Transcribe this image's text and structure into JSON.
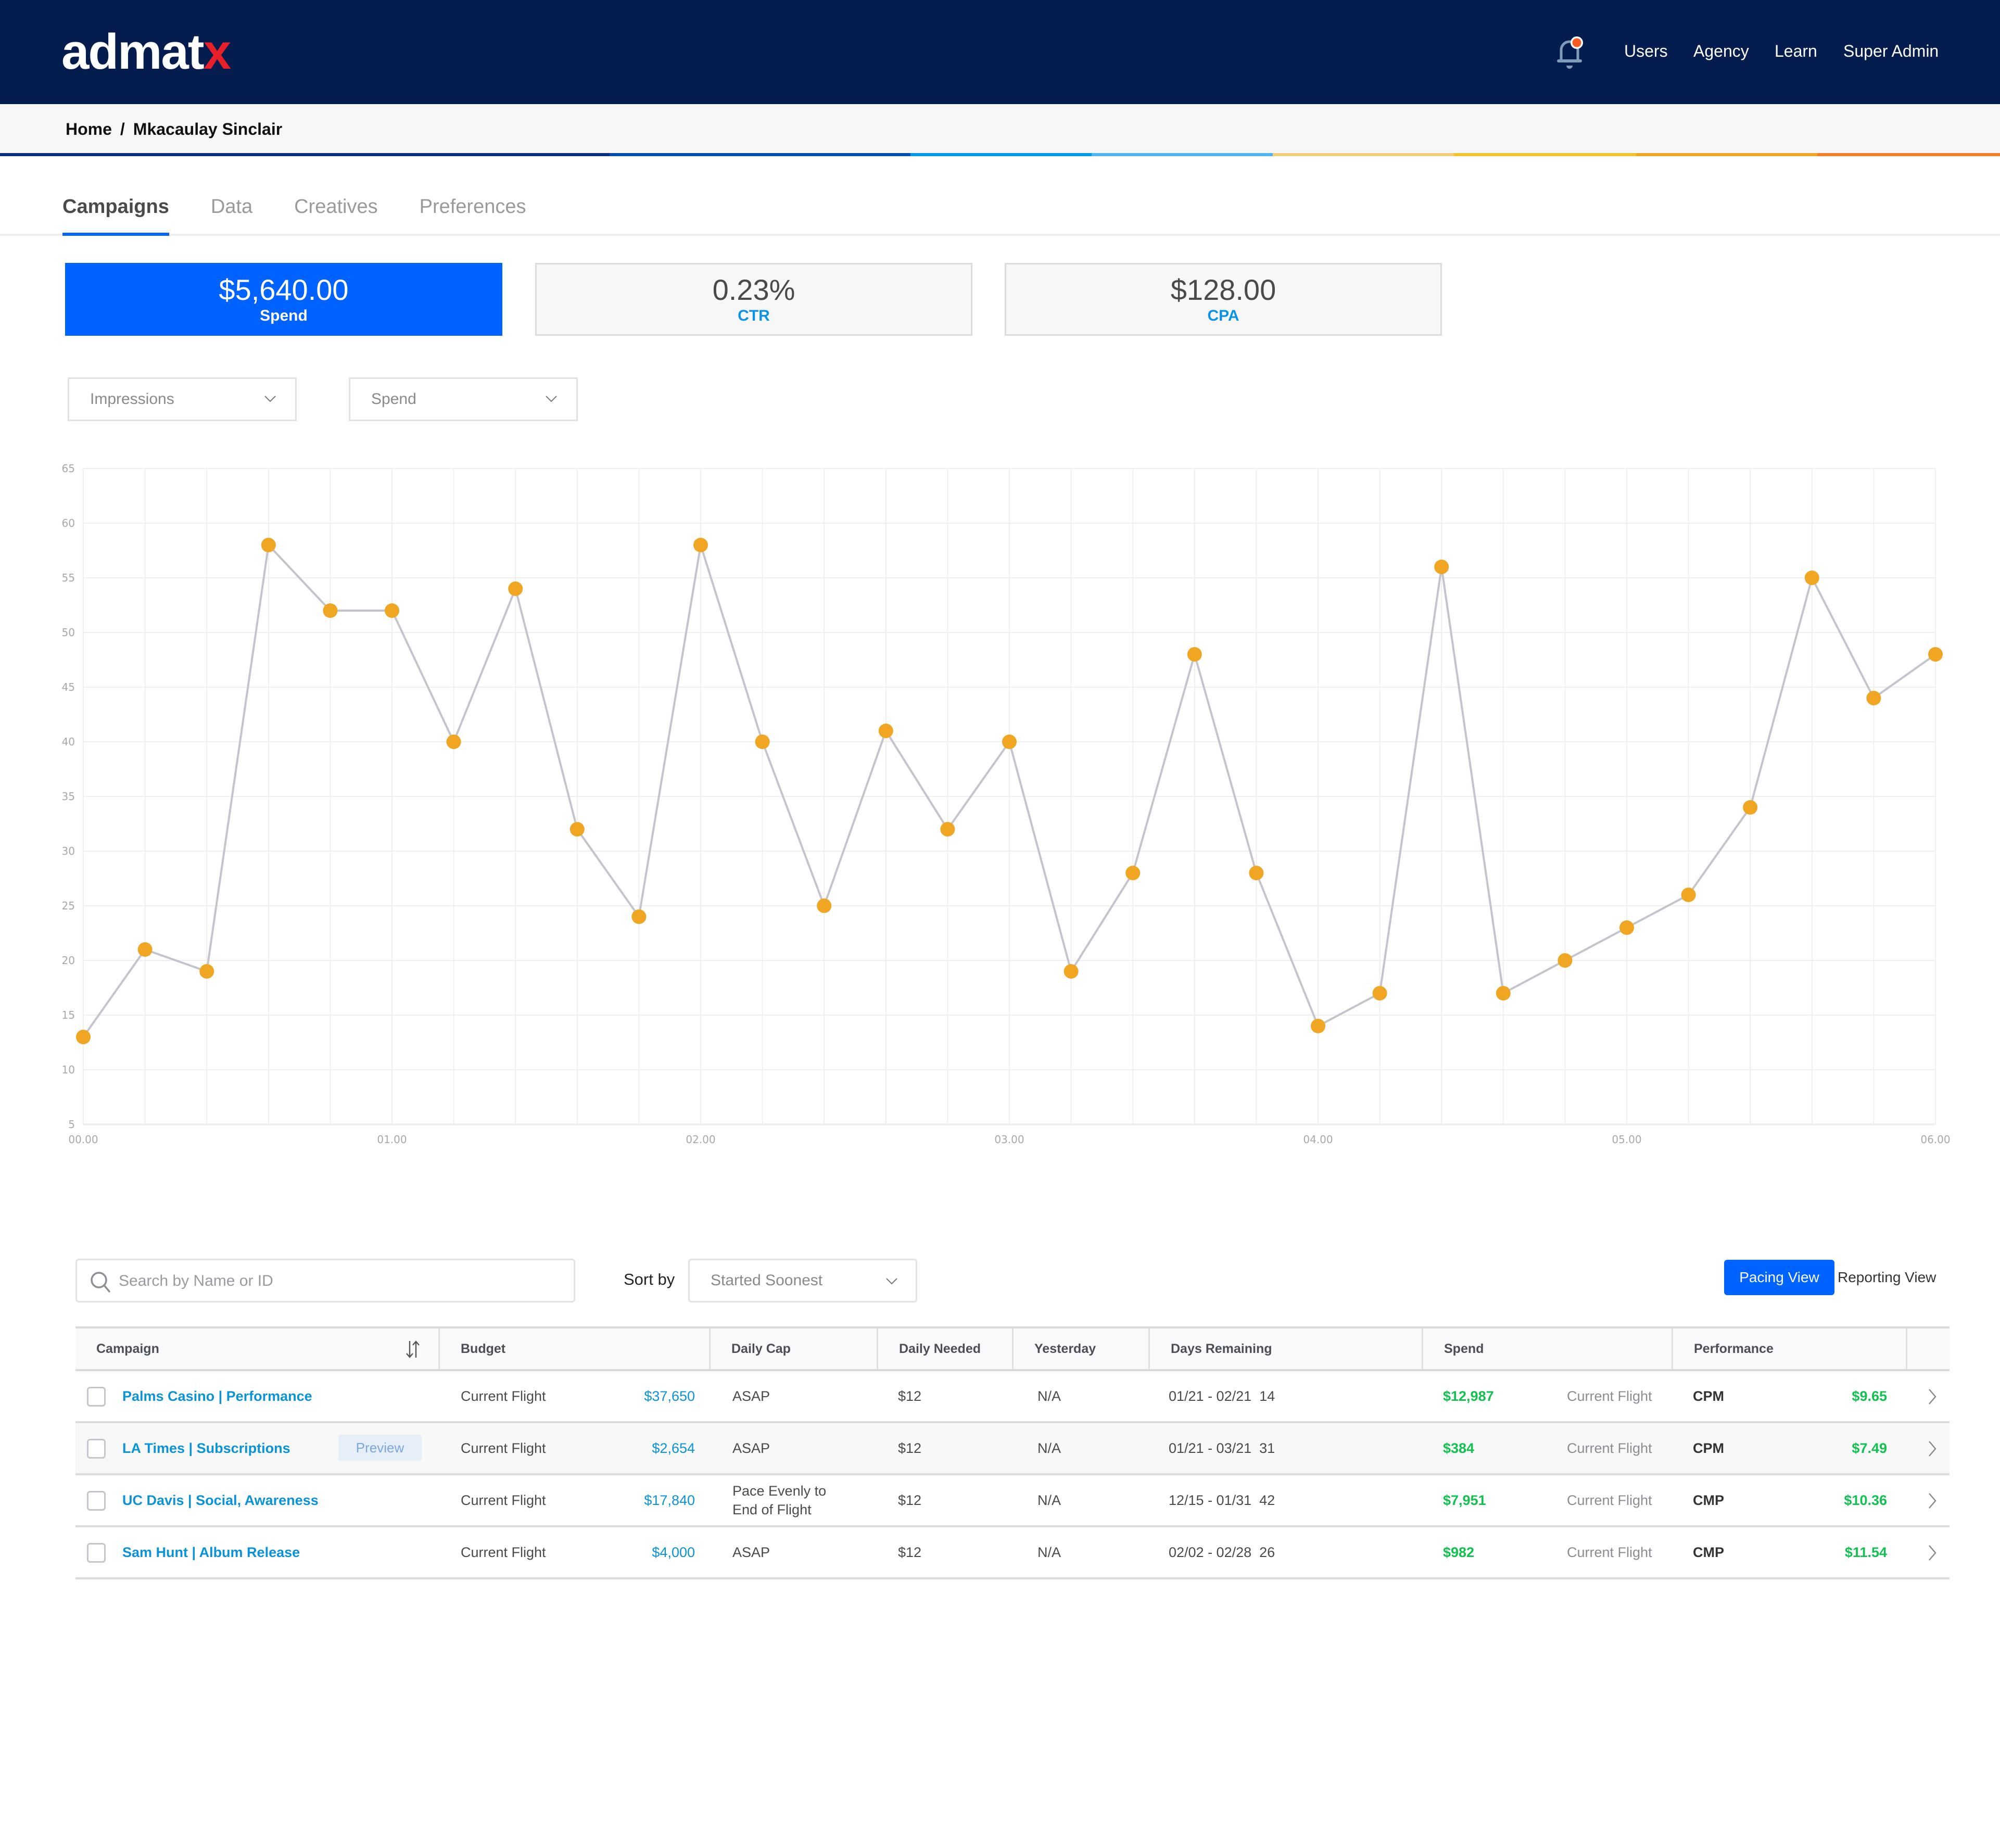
{
  "app": {
    "logo_main": "admat",
    "logo_accent": "x",
    "brand_colors": {
      "navy": "#041C4E",
      "accent_red": "#E8202A",
      "primary_blue": "#0062FF",
      "link_blue": "#0B93D9",
      "positive_green": "#12C150",
      "chart_point": "#F0A623",
      "chart_line": "#C4C4CC"
    }
  },
  "header": {
    "notification_icon": "bell-icon",
    "has_notification_badge": true,
    "nav": [
      {
        "label": "Users"
      },
      {
        "label": "Agency"
      },
      {
        "label": "Learn"
      },
      {
        "label": "Super Admin"
      }
    ]
  },
  "breadcrumb": {
    "items": [
      "Home",
      "Mkacaulay Sinclair"
    ],
    "separator": "/"
  },
  "stripe_colors": [
    "#032E82",
    "#004DB6",
    "#0098F0",
    "#4CB6F5",
    "#F2CE7A",
    "#F2C12E",
    "#F0A422",
    "#F77A25"
  ],
  "tabs": [
    {
      "label": "Campaigns",
      "active": true
    },
    {
      "label": "Data",
      "active": false
    },
    {
      "label": "Creatives",
      "active": false
    },
    {
      "label": "Preferences",
      "active": false
    }
  ],
  "kpis": [
    {
      "value": "$5,640.00",
      "label": "Spend",
      "active": true
    },
    {
      "value": "0.23%",
      "label": "CTR",
      "active": false
    },
    {
      "value": "$128.00",
      "label": "CPA",
      "active": false
    }
  ],
  "metric_selects": [
    {
      "value": "Impressions"
    },
    {
      "value": "Spend"
    }
  ],
  "chart_data": {
    "type": "line",
    "title": "",
    "xlabel": "",
    "ylabel": "",
    "ylim": [
      5,
      65
    ],
    "yticks": [
      5,
      10,
      15,
      20,
      25,
      30,
      35,
      40,
      45,
      50,
      55,
      60,
      65
    ],
    "xlim": [
      0,
      6
    ],
    "xtick_labels": [
      "00.00",
      "01.00",
      "02.00",
      "03.00",
      "04.00",
      "05.00",
      "06.00"
    ],
    "grid": true,
    "legend": "none",
    "series": [
      {
        "name": "Impressions",
        "x": [
          0,
          0.2,
          0.4,
          0.6,
          0.8,
          1.0,
          1.2,
          1.4,
          1.6,
          1.8,
          2.0,
          2.2,
          2.4,
          2.6,
          2.8,
          3.0,
          3.2,
          3.4,
          3.6,
          3.8,
          4.0,
          4.2,
          4.4,
          4.6,
          4.8,
          5.0,
          5.2,
          5.4,
          5.6,
          5.8,
          6.0
        ],
        "values": [
          13,
          21,
          19,
          58,
          52,
          52,
          40,
          54,
          32,
          24,
          58,
          40,
          25,
          41,
          32,
          40,
          19,
          28,
          48,
          28,
          14,
          17,
          56,
          17,
          20,
          23,
          26,
          34,
          55,
          44,
          48
        ]
      }
    ]
  },
  "toolbar": {
    "search_placeholder": "Search by Name or ID",
    "search_value": "",
    "sort_label": "Sort by",
    "sort_value": "Started Soonest",
    "view_buttons": [
      {
        "label": "Pacing View",
        "active": true
      },
      {
        "label": "Reporting View",
        "active": false
      }
    ]
  },
  "table": {
    "columns": [
      "Campaign",
      "Budget",
      "Daily Cap",
      "Daily Needed",
      "Yesterday",
      "Days Remaining",
      "Spend",
      "Performance",
      ""
    ],
    "rows": [
      {
        "campaign": "Palms Casino | Performance",
        "preview": "",
        "budget_label": "Current Flight",
        "budget": "$37,650",
        "daily_cap": "ASAP",
        "daily_needed": "$12",
        "yesterday": "N/A",
        "days_remaining": "01/21 - 02/21  14",
        "spend": "$12,987",
        "spend_label": "Current Flight",
        "perf_metric": "CPM",
        "perf_value": "$9.65"
      },
      {
        "campaign": "LA Times | Subscriptions",
        "preview": "Preview",
        "budget_label": "Current Flight",
        "budget": "$2,654",
        "daily_cap": "ASAP",
        "daily_needed": "$12",
        "yesterday": "N/A",
        "days_remaining": "01/21 - 03/21  31",
        "spend": "$384",
        "spend_label": "Current Flight",
        "perf_metric": "CPM",
        "perf_value": "$7.49"
      },
      {
        "campaign": "UC Davis | Social, Awareness",
        "preview": "",
        "budget_label": "Current Flight",
        "budget": "$17,840",
        "daily_cap": "Pace Evenly to End of Flight",
        "daily_needed": "$12",
        "yesterday": "N/A",
        "days_remaining": "12/15 - 01/31  42",
        "spend": "$7,951",
        "spend_label": "Current Flight",
        "perf_metric": "CMP",
        "perf_value": "$10.36"
      },
      {
        "campaign": "Sam Hunt | Album Release",
        "preview": "",
        "budget_label": "Current Flight",
        "budget": "$4,000",
        "daily_cap": "ASAP",
        "daily_needed": "$12",
        "yesterday": "N/A",
        "days_remaining": "02/02 - 02/28  26",
        "spend": "$982",
        "spend_label": "Current Flight",
        "perf_metric": "CMP",
        "perf_value": "$11.54"
      }
    ]
  }
}
